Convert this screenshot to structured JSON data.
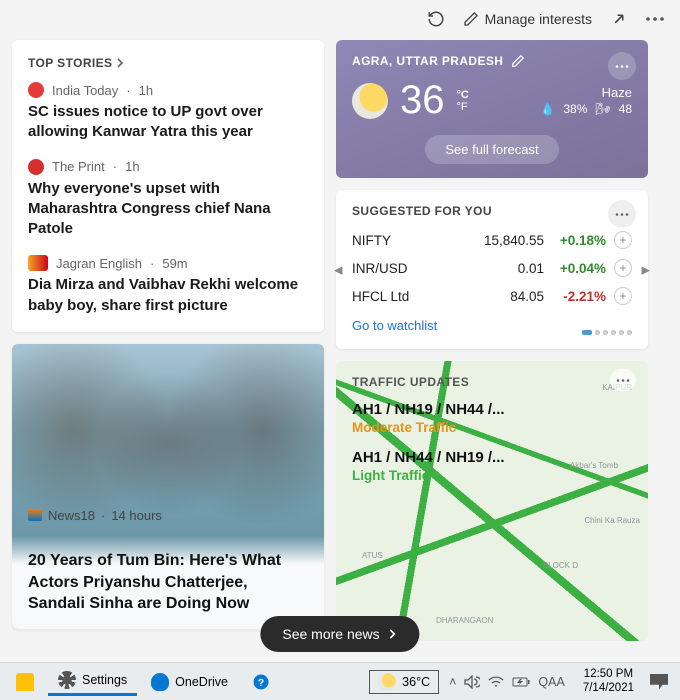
{
  "toolbar": {
    "manage_label": "Manage interests"
  },
  "top_stories": {
    "header": "TOP STORIES",
    "items": [
      {
        "source": "India Today",
        "time": "1h",
        "title": "SC issues notice to UP govt over allowing Kanwar Yatra this year"
      },
      {
        "source": "The Print",
        "time": "1h",
        "title": "Why everyone's upset with Maharashtra Congress chief Nana Patole"
      },
      {
        "source": "Jagran English",
        "time": "59m",
        "title": "Dia Mirza and Vaibhav Rekhi welcome baby boy, share first picture"
      }
    ]
  },
  "featured": {
    "source": "News18",
    "time": "14 hours",
    "title": "20 Years of Tum Bin: Here's What Actors Priyanshu Chatterjee, Sandali Sinha are Doing Now"
  },
  "weather": {
    "location": "AGRA, UTTAR PRADESH",
    "temp": "36",
    "unit_c": "°C",
    "unit_f": "°F",
    "condition": "Haze",
    "humidity": "38%",
    "wind": "48",
    "forecast_btn": "See full forecast"
  },
  "suggested": {
    "header": "SUGGESTED FOR YOU",
    "rows": [
      {
        "name": "NIFTY",
        "value": "15,840.55",
        "change": "+0.18%",
        "dir": "up"
      },
      {
        "name": "INR/USD",
        "value": "0.01",
        "change": "+0.04%",
        "dir": "up"
      },
      {
        "name": "HFCL Ltd",
        "value": "84.05",
        "change": "-2.21%",
        "dir": "down"
      }
    ],
    "watchlist": "Go to watchlist"
  },
  "traffic": {
    "header": "TRAFFIC UPDATES",
    "routes": [
      {
        "name": "AH1 / NH19 / NH44 /...",
        "status": "Moderate Traffic",
        "level": "moderate"
      },
      {
        "name": "AH1 / NH44 / NH19 /...",
        "status": "Light Traffic",
        "level": "light"
      }
    ],
    "map_labels": {
      "kaipur": "KAIPUR",
      "tomb": "Akbar's Tomb",
      "chini": "Chini Ka Rauza",
      "atus": "ATUS",
      "blockd": "BLOCK D",
      "dharangaon": "DHARANGAON"
    }
  },
  "see_more": "See more news",
  "taskbar": {
    "settings": "Settings",
    "onedrive": "OneDrive",
    "weather_temp": "36°C",
    "lang": "QAA",
    "time": "12:50 PM",
    "date": "7/14/2021"
  }
}
